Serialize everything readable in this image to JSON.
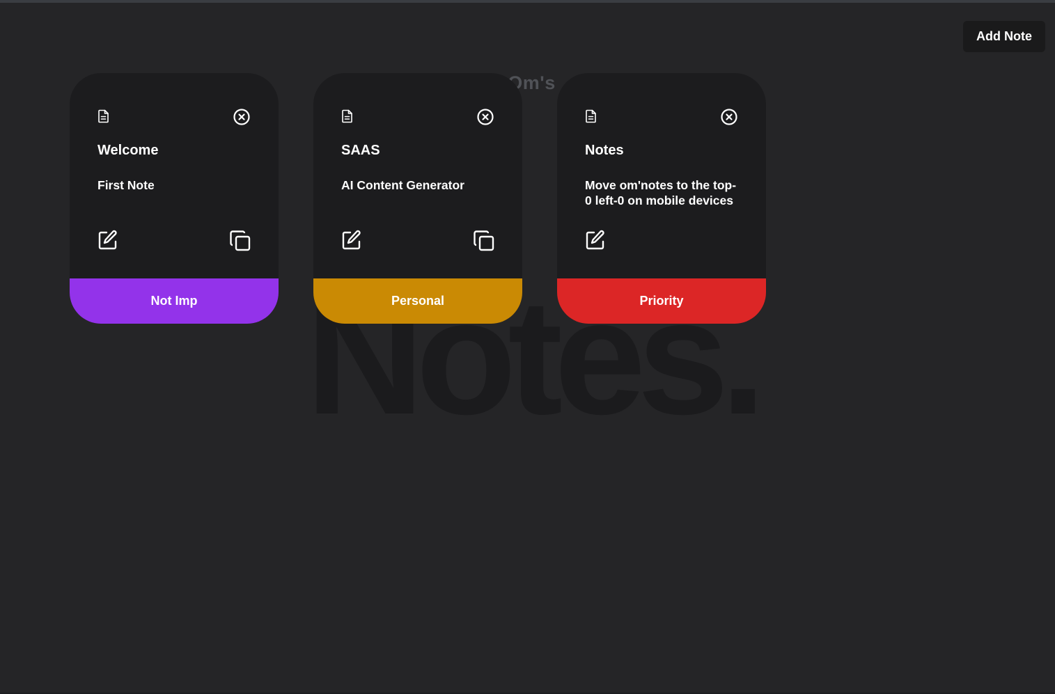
{
  "background": {
    "subtitle": "Om's",
    "title": "Notes."
  },
  "toolbar": {
    "add_note_label": "Add Note"
  },
  "cards": [
    {
      "title": "Welcome",
      "body": "First Note",
      "tag": "Not Imp",
      "tag_color": "#9333ea",
      "icons": [
        "document-icon",
        "close-icon",
        "edit-icon",
        "copy-icon"
      ]
    },
    {
      "title": "SAAS",
      "body": "AI Content Generator",
      "tag": "Personal",
      "tag_color": "#ca8a04",
      "icons": [
        "document-icon",
        "close-icon",
        "edit-icon",
        "copy-icon"
      ]
    },
    {
      "title": "Notes",
      "body": "Move om'notes to the top-0 left-0 on mobile devices",
      "tag": "Priority",
      "tag_color": "#dc2626",
      "icons": [
        "document-icon",
        "close-icon",
        "edit-icon"
      ]
    }
  ],
  "colors": {
    "page_background": "#252527",
    "card_background": "#1c1c1e",
    "button_background": "#1a1a1b"
  }
}
